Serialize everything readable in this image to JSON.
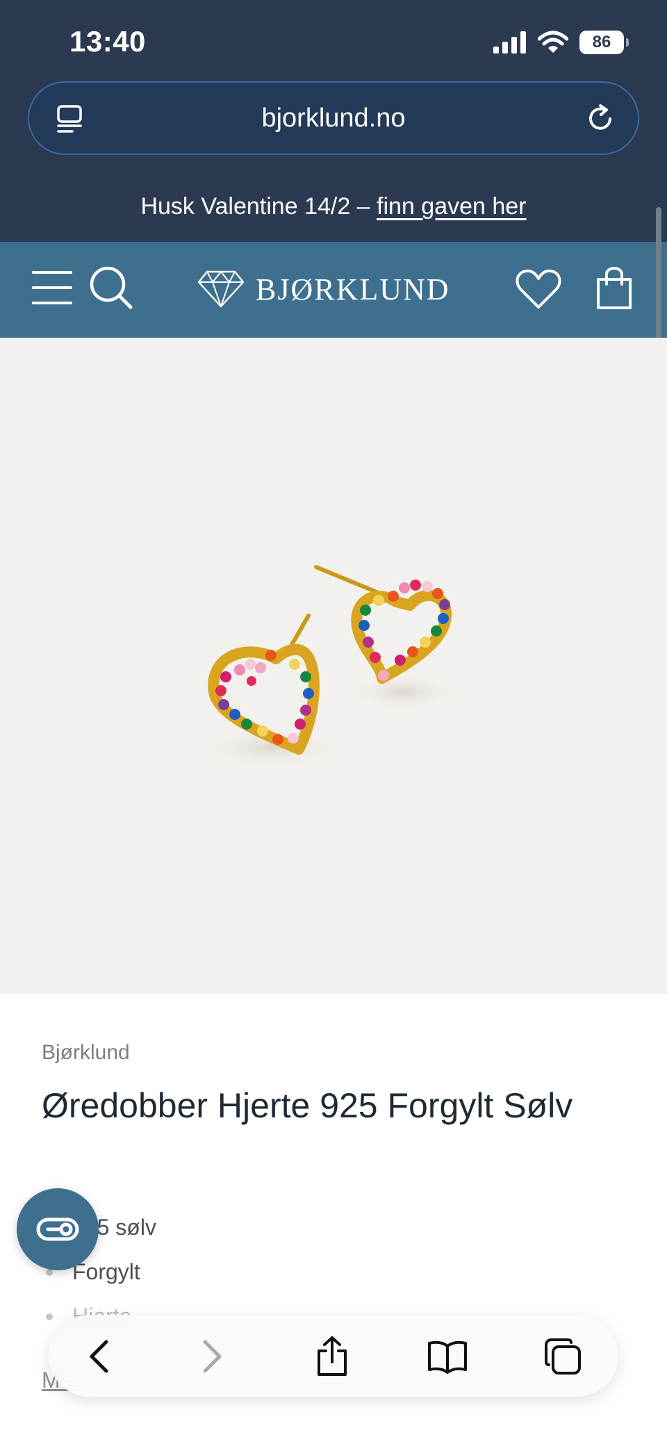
{
  "status_bar": {
    "time": "13:40",
    "battery": "86"
  },
  "browser": {
    "url": "bjorklund.no"
  },
  "promo": {
    "text": "Husk Valentine 14/2  – ",
    "link": "finn gaven her"
  },
  "header": {
    "logo_text": "BJØRKLUND"
  },
  "product": {
    "brand": "Bjørklund",
    "title": "Øredobber Hjerte 925 Forgylt Sølv",
    "features": [
      "925 sølv",
      "Forgylt",
      "Hjerte"
    ],
    "more_link": "Mer"
  },
  "colors": {
    "browser_chrome": "#2b3a51",
    "header": "#3e6f8e",
    "image_background": "#f3f1ed",
    "gold": "#d9a520"
  },
  "icons": {
    "tabs": "tabs-icon",
    "reload": "reload-icon",
    "menu": "menu-icon",
    "search": "search-icon",
    "wishlist": "heart-icon",
    "cart": "bag-icon",
    "chat": "chat-icon",
    "back": "chevron-left-icon",
    "forward": "chevron-right-icon",
    "share": "share-icon",
    "bookmarks": "book-icon",
    "tab_switcher": "tabs-overview-icon"
  }
}
